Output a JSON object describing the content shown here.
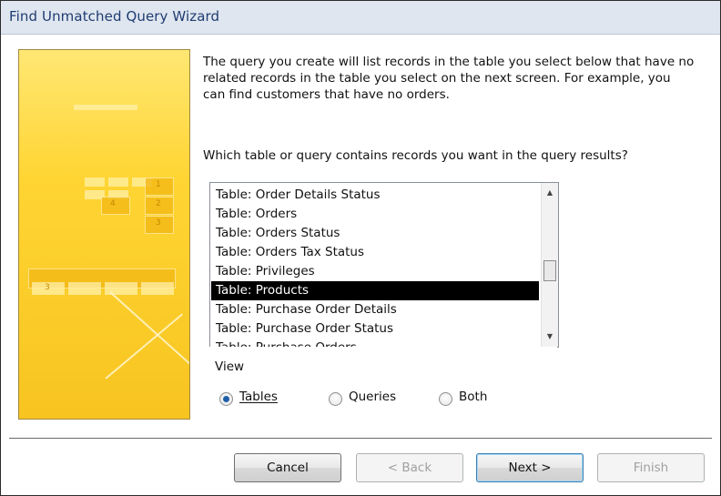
{
  "window": {
    "title": "Find Unmatched Query Wizard"
  },
  "description": "The query you create will list records in the table you select below that have no related records in the table you select on the next screen. For example, you can find customers that have no orders.",
  "question": "Which table or query contains records you want in the query results?",
  "list": {
    "items": [
      "Table: Order Details Status",
      "Table: Orders",
      "Table: Orders Status",
      "Table: Orders Tax Status",
      "Table: Privileges",
      "Table: Products",
      "Table: Purchase Order Details",
      "Table: Purchase Order Status",
      "Table: Purchase Orders"
    ],
    "selected": "Table: Products",
    "scroll_position": 0.55
  },
  "view": {
    "label": "View",
    "options": [
      "Tables",
      "Queries",
      "Both"
    ],
    "selected": "Tables"
  },
  "buttons": {
    "cancel": "Cancel",
    "back": "< Back",
    "next": "Next >",
    "finish": "Finish"
  },
  "art_numbers": [
    "1",
    "2",
    "3",
    "4",
    "3"
  ],
  "colors": {
    "title_text": "#1f3c72",
    "art_yellow": "#ffd533",
    "selection_bg": "#000000",
    "radio_dot": "#1f5fa8"
  }
}
